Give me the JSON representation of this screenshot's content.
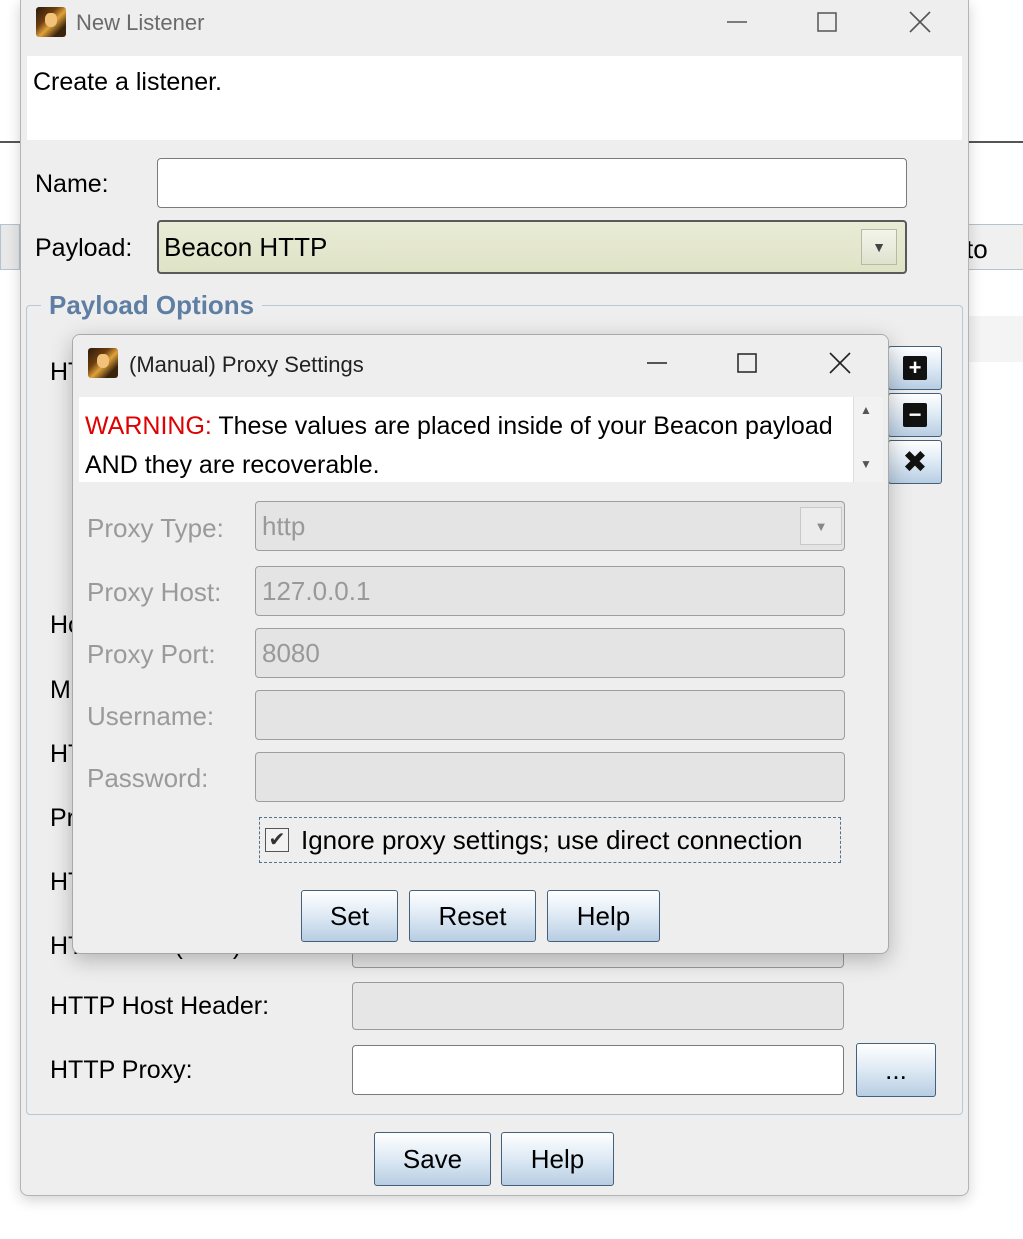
{
  "background": {
    "partial_text": "to"
  },
  "window": {
    "title": "New Listener",
    "header_text": "Create a listener.",
    "name": {
      "label": "Name:",
      "value": ""
    },
    "payload": {
      "label": "Payload:",
      "value": "Beacon HTTP"
    },
    "payload_options": {
      "title": "Payload Options",
      "partial_labels": [
        "HT",
        "Ho",
        "Ma",
        "HT",
        "Pr",
        "HT",
        "HTTP Port (Bind):"
      ],
      "http_host_header": {
        "label": "HTTP Host Header:",
        "value": ""
      },
      "http_proxy": {
        "label": "HTTP Proxy:",
        "value": "",
        "button": "..."
      }
    },
    "buttons": {
      "save": "Save",
      "help": "Help"
    }
  },
  "dialog": {
    "title": "(Manual) Proxy Settings",
    "warning_prefix": "WARNING:",
    "warning_text": " These values are placed inside of your Beacon payload AND they are recoverable.",
    "fields": {
      "proxy_type": {
        "label": "Proxy Type:",
        "value": "http"
      },
      "proxy_host": {
        "label": "Proxy Host:",
        "value": "127.0.0.1"
      },
      "proxy_port": {
        "label": "Proxy Port:",
        "value": "8080"
      },
      "username": {
        "label": "Username:",
        "value": ""
      },
      "password": {
        "label": "Password:",
        "value": ""
      }
    },
    "ignore_proxy": {
      "label": "Ignore proxy settings; use direct connection",
      "checked": true
    },
    "buttons": {
      "set": "Set",
      "reset": "Reset",
      "help": "Help"
    }
  }
}
